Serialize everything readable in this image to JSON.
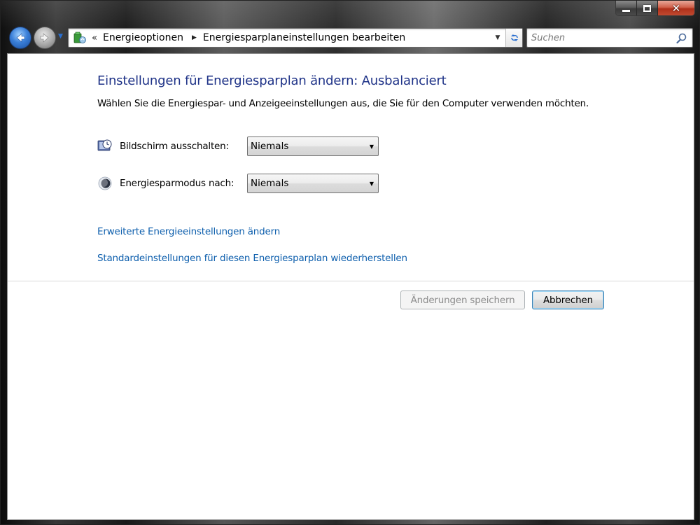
{
  "window": {
    "caption": {
      "minimize_glyph": "",
      "close_glyph": "✕"
    }
  },
  "nav": {
    "address": {
      "overflow": "«",
      "crumbs": [
        "Energieoptionen",
        "Energiesparplaneinstellungen bearbeiten"
      ],
      "separator": "▶",
      "dropdown": "▼"
    },
    "search": {
      "placeholder": "Suchen"
    }
  },
  "main": {
    "title": "Einstellungen für Energiesparplan ändern: Ausbalanciert",
    "subtitle": "Wählen Sie die Energiespar- und Anzeigeeinstellungen aus, die Sie für den Computer verwenden möchten.",
    "settings": [
      {
        "label": "Bildschirm ausschalten:",
        "value": "Niemals",
        "icon": "monitor-clock-icon"
      },
      {
        "label": "Energiesparmodus nach:",
        "value": "Niemals",
        "icon": "moon-icon"
      }
    ],
    "links": [
      "Erweiterte Energieeinstellungen ändern",
      "Standardeinstellungen für diesen Energiesparplan wiederherstellen"
    ],
    "buttons": {
      "save": "Änderungen speichern",
      "cancel": "Abbrechen"
    },
    "select_chevron": "▼"
  },
  "colors": {
    "title": "#1e3287",
    "link": "#0e5fad",
    "disabled_text": "#8d8d8d"
  }
}
